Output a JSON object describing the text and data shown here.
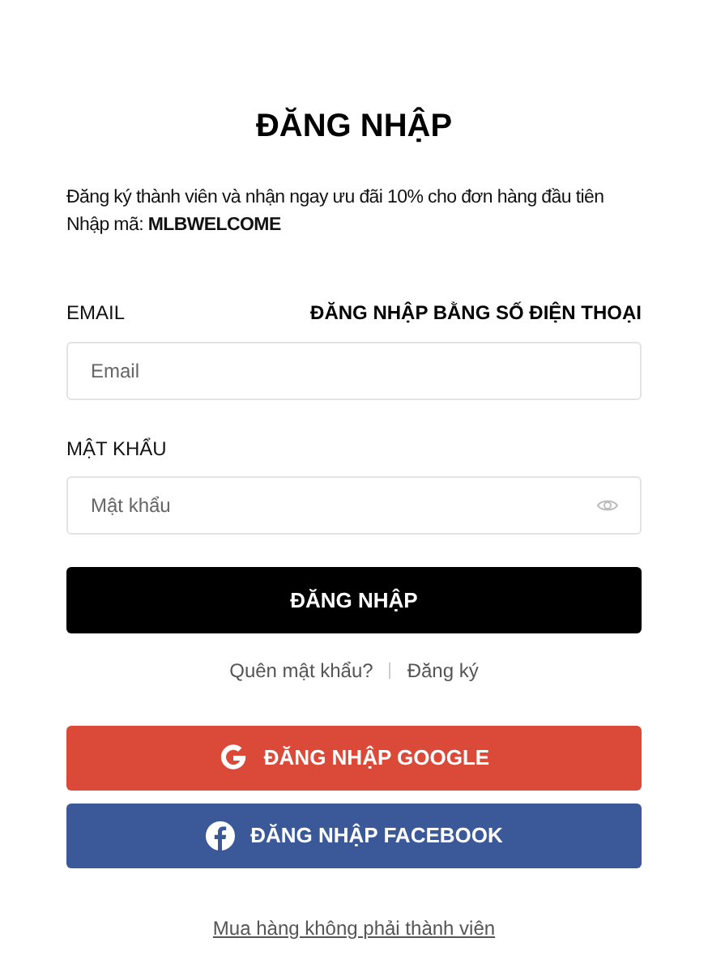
{
  "title": "ĐĂNG NHẬP",
  "promo": [
    "Đăng ký thành viên và nhận ngay ưu đãi 10% cho đơn hàng đầu tiên",
    "Nhập mã: **MLBWELCOME**"
  ],
  "email": {
    "label": "EMAIL",
    "placeholder": "Email"
  },
  "phone_login_link": "ĐĂNG NHẬP BẰNG SỐ ĐIỆN THOẠI",
  "password": {
    "label": "MẬT KHẨU",
    "placeholder": "Mật khẩu"
  },
  "login_button": "ĐĂNG NHẬP",
  "links": [
    "Quên mật khẩu?",
    "Đăng ký"
  ],
  "social_buttons": [
    {
      "kind": "google",
      "label": "ĐĂNG NHẬP GOOGLE"
    },
    {
      "kind": "facebook",
      "label": "ĐĂNG NHẬP FACEBOOK"
    }
  ],
  "guest_link": "Mua hàng không phải thành viên"
}
